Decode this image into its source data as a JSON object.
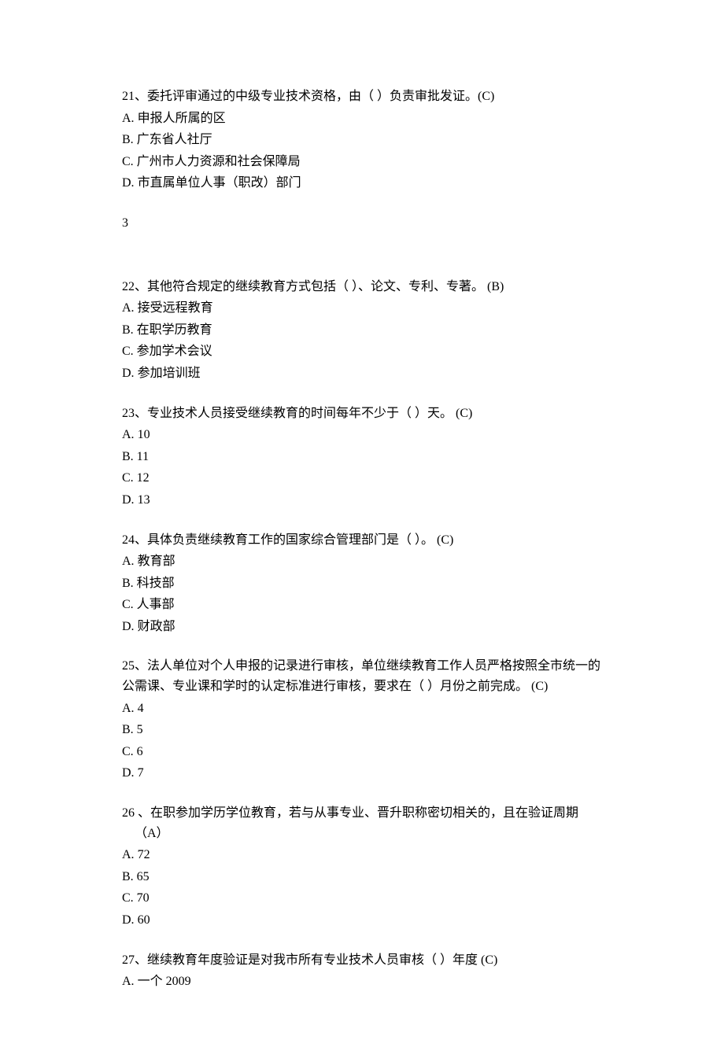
{
  "questions": [
    {
      "number": "21",
      "text": "、委托评审通过的中级专业技术资格，由（  ）负责审批发证。",
      "answer": "(C)",
      "options": [
        {
          "prefix": "A.",
          "text": " 申报人所属的区"
        },
        {
          "prefix": "B.",
          "text": " 广东省人社厅"
        },
        {
          "prefix": "C.",
          "text": " 广州市人力资源和社会保障局"
        },
        {
          "prefix": "D.",
          "text": " 市直属单位人事（职改）部门"
        }
      ]
    },
    {
      "number": "22",
      "text": "、其他符合规定的继续教育方式包括（  ）、论文、专利、专著。    ",
      "answer": "(B)",
      "options": [
        {
          "prefix": "A.",
          "text": " 接受远程教育"
        },
        {
          "prefix": "B.",
          "text": " 在职学历教育"
        },
        {
          "prefix": "C.",
          "text": " 参加学术会议"
        },
        {
          "prefix": "D.",
          "text": " 参加培训班"
        }
      ]
    },
    {
      "number": "23",
      "text": "、专业技术人员接受继续教育的时间每年不少于（  ）天。      ",
      "answer": "(C)",
      "options": [
        {
          "prefix": "A.",
          "text": " 10"
        },
        {
          "prefix": "B.",
          "text": " 11"
        },
        {
          "prefix": "C.",
          "text": " 12"
        },
        {
          "prefix": "D.",
          "text": " 13"
        }
      ]
    },
    {
      "number": "24",
      "text": "、具体负责继续教育工作的国家综合管理部门是（  ）。      ",
      "answer": "(C)",
      "options": [
        {
          "prefix": "A.",
          "text": " 教育部"
        },
        {
          "prefix": "B.",
          "text": " 科技部"
        },
        {
          "prefix": "C.",
          "text": " 人事部"
        },
        {
          "prefix": "D.",
          "text": " 财政部"
        }
      ]
    },
    {
      "number": "25",
      "text": "、法人单位对个人申报的记录进行审核，单位继续教育工作人员严格按照全市统一的公需课、专业课和学时的认定标准进行审核，要求在（  ）月份之前完成。  ",
      "answer": "(C)",
      "options": [
        {
          "prefix": "A.",
          "text": " 4"
        },
        {
          "prefix": "B.",
          "text": " 5"
        },
        {
          "prefix": "C.",
          "text": " 6"
        },
        {
          "prefix": "D.",
          "text": " 7"
        }
      ]
    },
    {
      "number": "26",
      "text": " 、在职参加学历学位教育，若与从事专业、晋升职称密切相关的，且在验证周期",
      "answer": "（A）",
      "options": [
        {
          "prefix": "A.",
          "text": " 72"
        },
        {
          "prefix": "B.",
          "text": " 65"
        },
        {
          "prefix": "C.",
          "text": " 70"
        },
        {
          "prefix": "D.",
          "text": " 60"
        }
      ]
    },
    {
      "number": "27",
      "text": "、继续教育年度验证是对我市所有专业技术人员审核（  ）年度    ",
      "answer": "(C)",
      "options": [
        {
          "prefix": "A.",
          "text": "  一个    2009"
        }
      ]
    }
  ],
  "page_number": "3"
}
